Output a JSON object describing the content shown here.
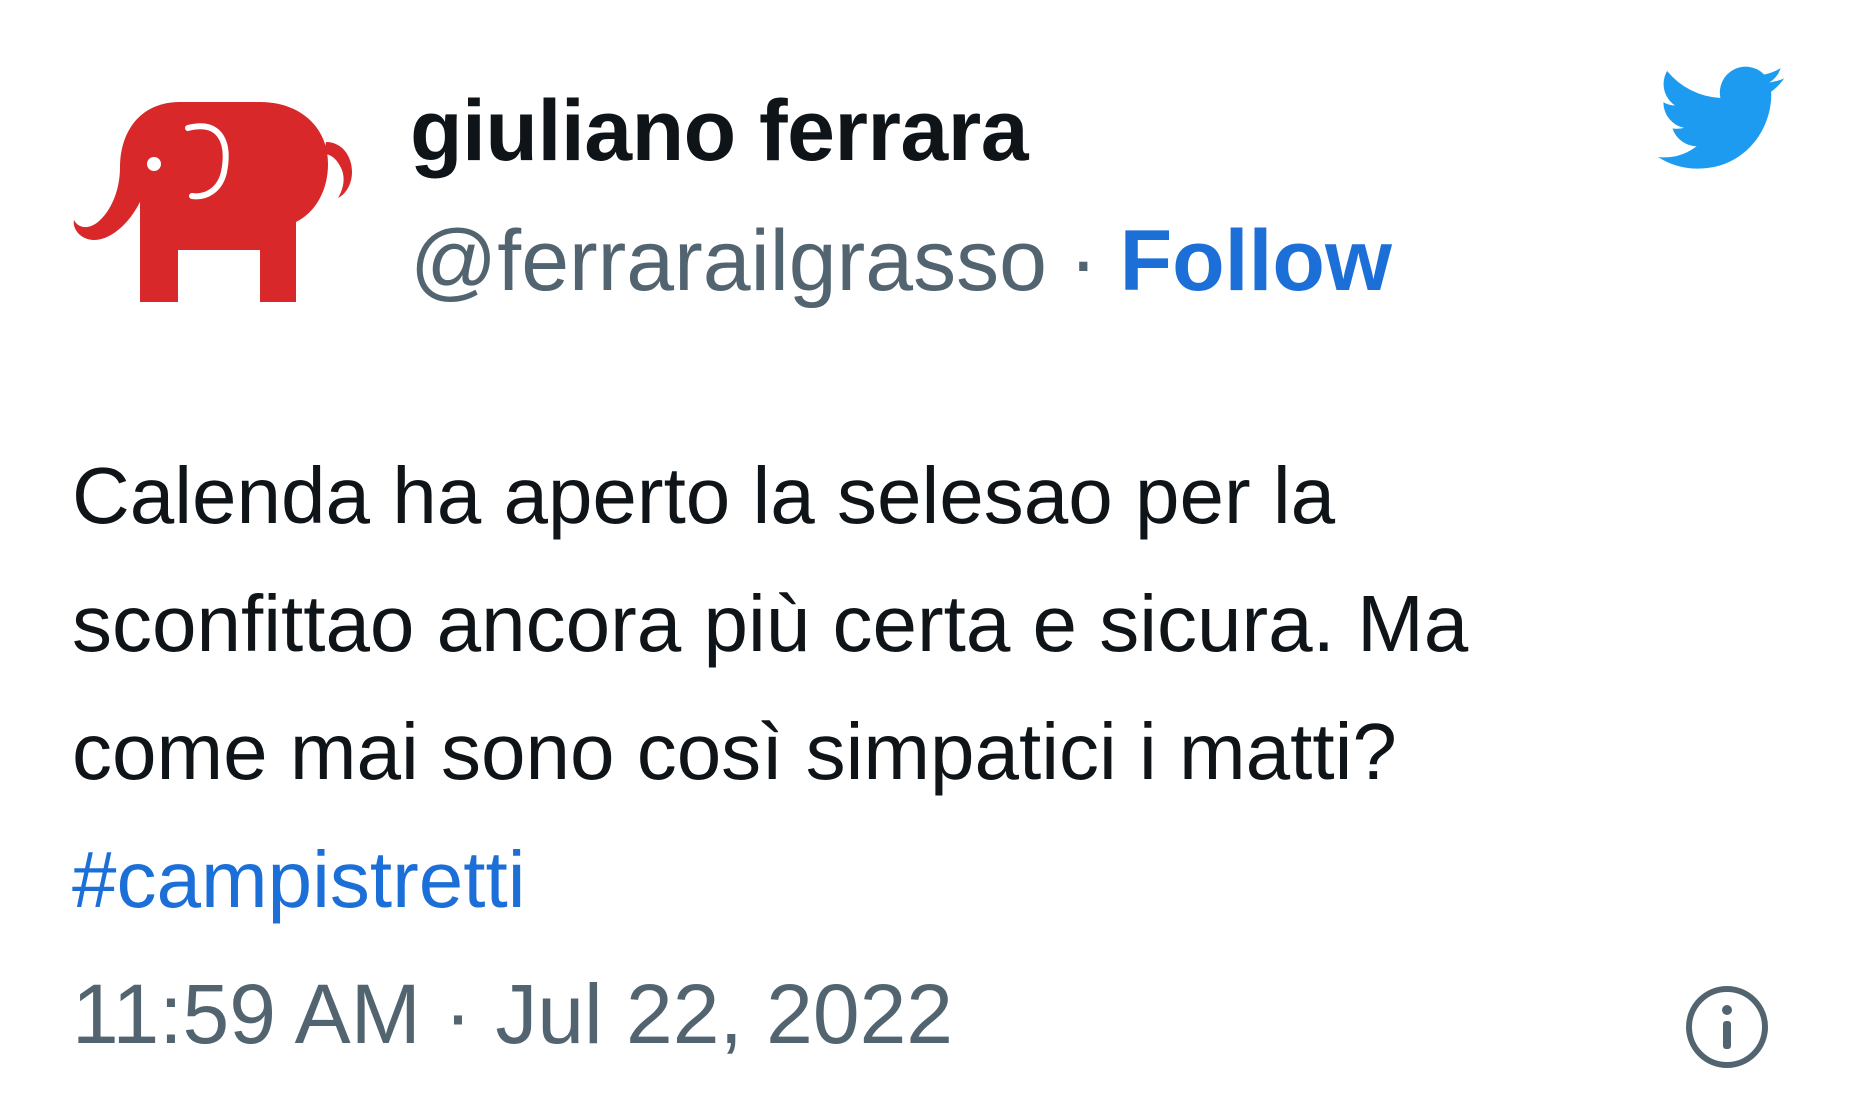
{
  "author": {
    "display_name": "giuliano ferrara",
    "handle": "@ferrarailgrasso",
    "separator": "·",
    "follow_label": "Follow",
    "avatar_icon": "red-elephant-icon",
    "avatar_color": "#d8282a"
  },
  "brand": {
    "icon": "twitter-bird-icon",
    "color": "#1d9bf0"
  },
  "tweet": {
    "lines": [
      "Calenda ha aperto la selesao per la",
      "sconfittao ancora più certa e sicura. Ma",
      "come mai sono così simpatici i matti?"
    ],
    "hashtag": "#campistretti",
    "timestamp": "11:59 AM · Jul 22, 2022"
  },
  "actions": {
    "info_icon": "info-icon"
  },
  "colors": {
    "link": "#1d6fd8",
    "secondary_text": "#536471",
    "primary_text": "#0f1419"
  }
}
